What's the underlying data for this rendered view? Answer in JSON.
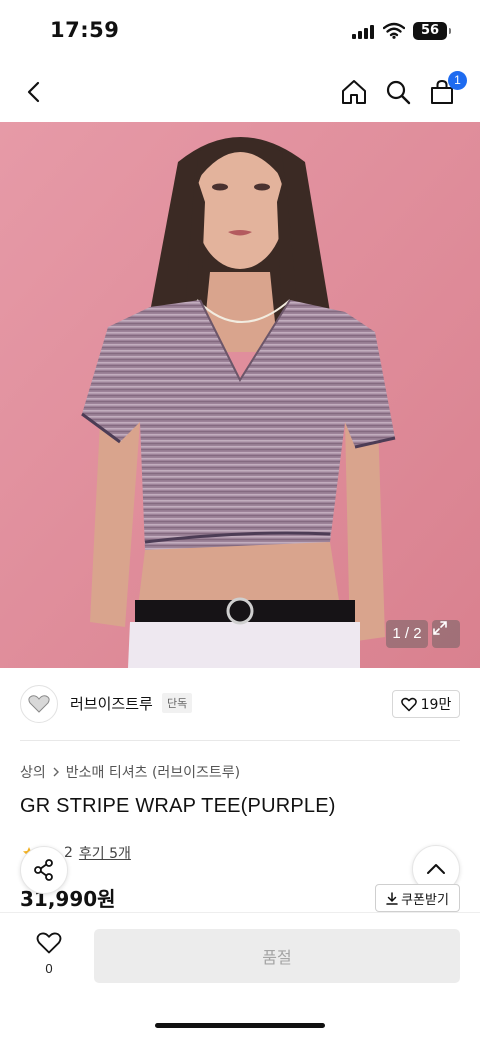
{
  "status_bar": {
    "time": "17:59",
    "battery": "56"
  },
  "nav": {
    "cart_count": "1"
  },
  "gallery": {
    "page_indicator": "1 / 2"
  },
  "brand": {
    "name": "러브이즈트루",
    "tag": "단독",
    "likes": "19만"
  },
  "breadcrumb": {
    "category": "상의",
    "subcategory": "반소매 티셔츠 (러브이즈트루)"
  },
  "product": {
    "title": "GR STRIPE WRAP TEE(PURPLE)",
    "rating_partial": "2",
    "review_link": "후기 5개",
    "price": "31,990원",
    "coupon_label": "쿠폰받기"
  },
  "bottom_bar": {
    "wish_count": "0",
    "buy_label": "품절"
  },
  "colors": {
    "accent_badge": "#1e6bf0",
    "hero_background": "#e28d9b",
    "shirt": "#9b8198"
  }
}
